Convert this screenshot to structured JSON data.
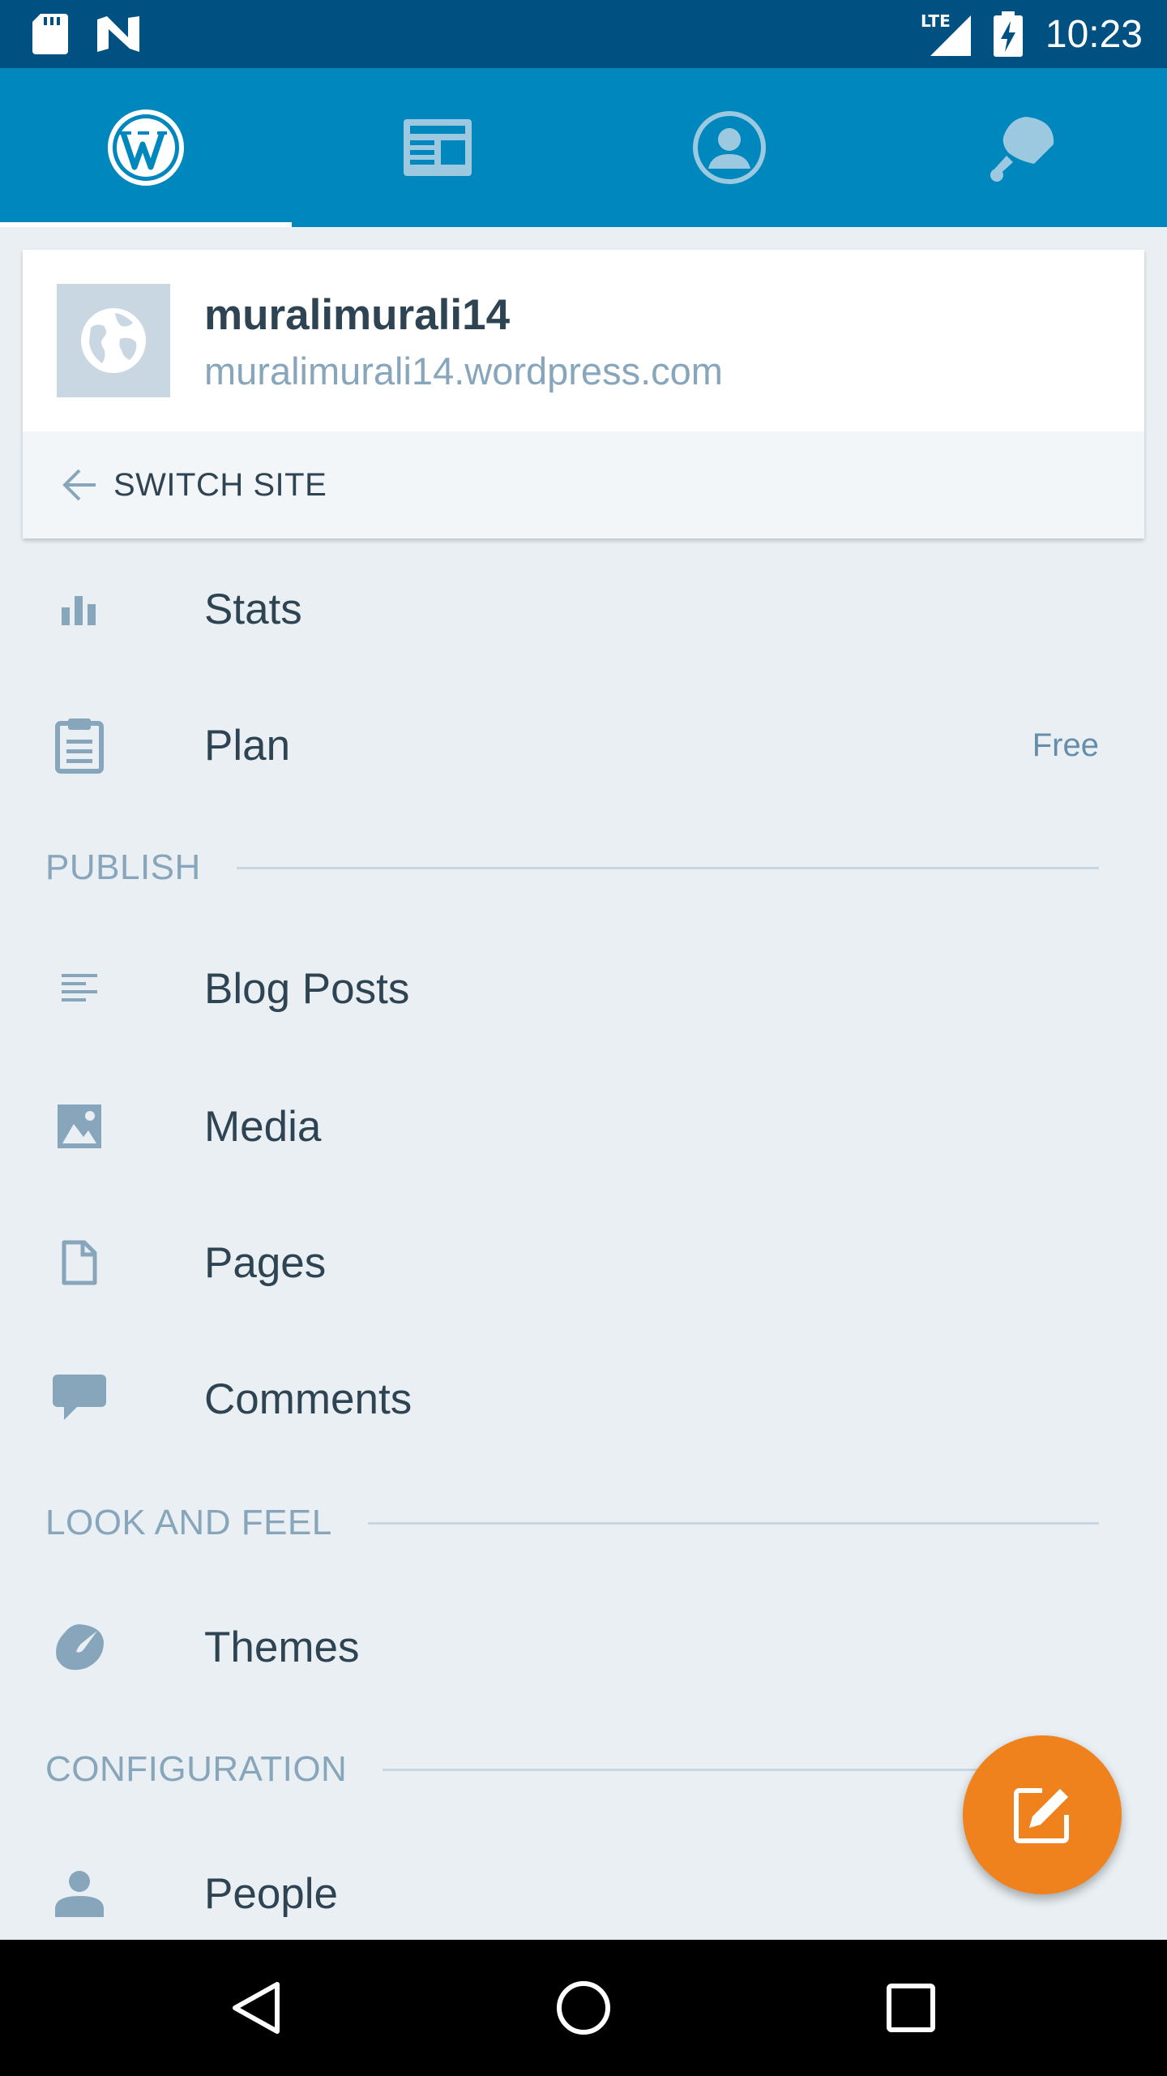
{
  "status_bar": {
    "time": "10:23",
    "network": "LTE",
    "icons": [
      "sd-card-icon",
      "n-notification-icon",
      "lte-signal-icon",
      "battery-charging-icon"
    ]
  },
  "tabs": [
    {
      "name": "my-site",
      "icon": "wordpress-icon",
      "selected": true
    },
    {
      "name": "reader",
      "icon": "reader-icon",
      "selected": false
    },
    {
      "name": "me",
      "icon": "profile-icon",
      "selected": false
    },
    {
      "name": "notifications",
      "icon": "bell-icon",
      "selected": false
    }
  ],
  "site": {
    "name": "muralimurali14",
    "url": "muralimurali14.wordpress.com",
    "switch_label": "SWITCH SITE"
  },
  "menu": {
    "stats": {
      "label": "Stats",
      "icon": "stats-icon"
    },
    "plan": {
      "label": "Plan",
      "value": "Free",
      "icon": "plan-icon"
    },
    "publish_header": "PUBLISH",
    "blog_posts": {
      "label": "Blog Posts",
      "icon": "posts-icon"
    },
    "media": {
      "label": "Media",
      "icon": "media-icon"
    },
    "pages": {
      "label": "Pages",
      "icon": "pages-icon"
    },
    "comments": {
      "label": "Comments",
      "icon": "comments-icon"
    },
    "look_header": "LOOK AND FEEL",
    "themes": {
      "label": "Themes",
      "icon": "themes-icon"
    },
    "config_header": "CONFIGURATION",
    "people": {
      "label": "People",
      "icon": "people-icon"
    }
  },
  "fab": {
    "icon": "edit-icon"
  },
  "nav_bar": {
    "icons": [
      "back-icon",
      "home-icon",
      "recents-icon"
    ]
  },
  "colors": {
    "status_bar": "#005082",
    "tab_bar": "#0087be",
    "background": "#e9eff3",
    "text": "#2e4453",
    "muted": "#87a6bc",
    "fab": "#f0821e"
  }
}
